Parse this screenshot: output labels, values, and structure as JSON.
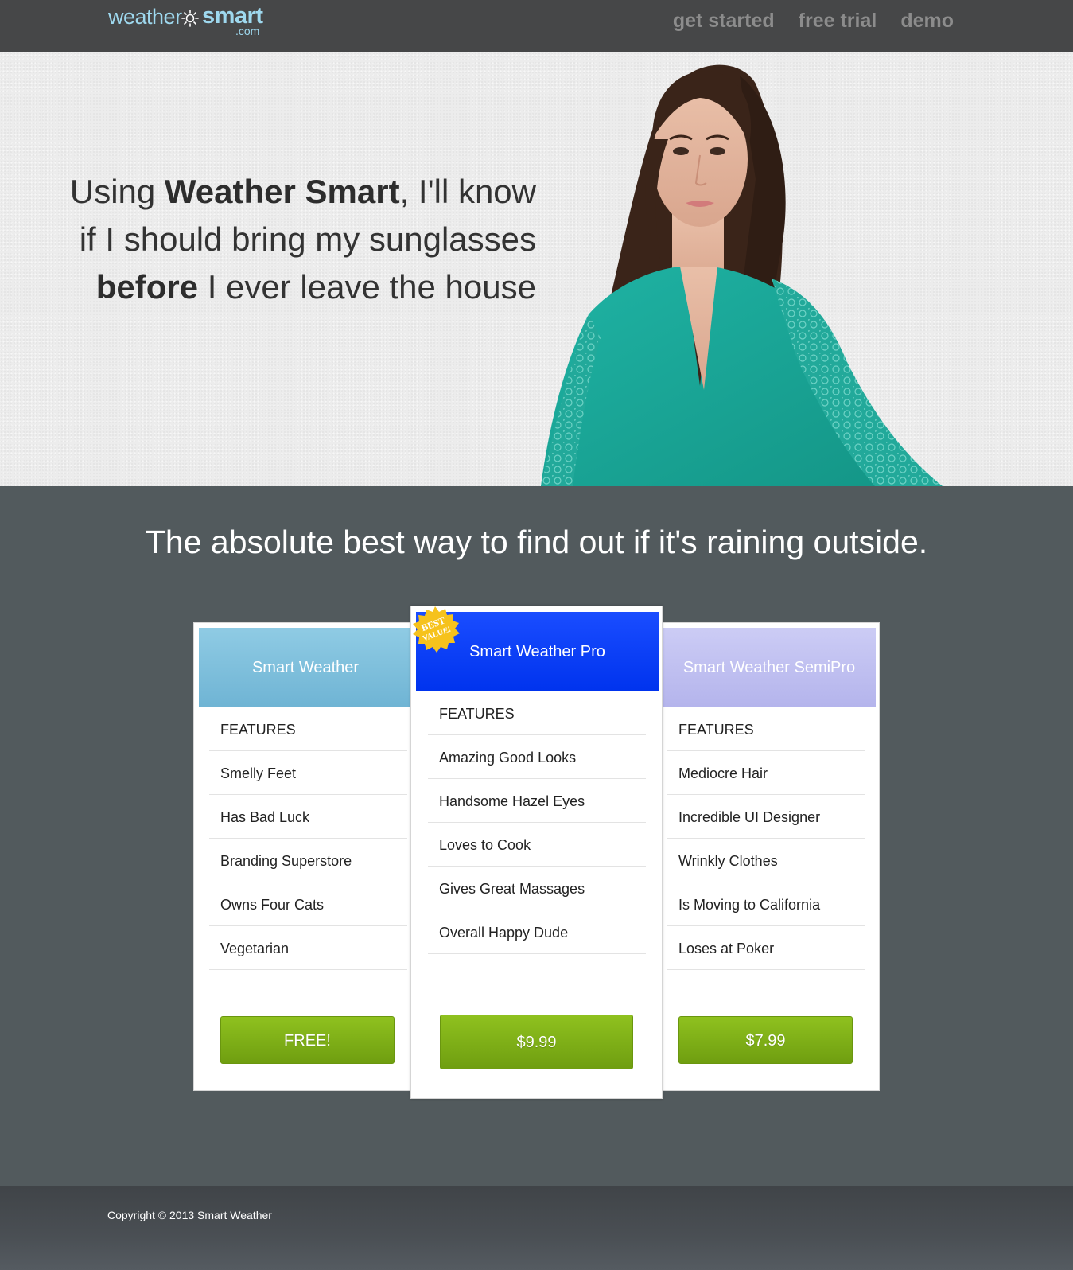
{
  "header": {
    "logo": {
      "word1": "weather",
      "word2": "smart",
      "domain": ".com"
    },
    "nav": [
      "get started",
      "free trial",
      "demo"
    ]
  },
  "hero": {
    "line1_pre": "Using ",
    "line1_bold": "Weather Smart",
    "line1_post": ", I'll know",
    "line2": "if I should bring my sunglasses",
    "line3_bold": "before",
    "line3_post": " I ever leave the house"
  },
  "tagline": "The absolute best way to find out if it's raining outside.",
  "plans": [
    {
      "name": "Smart Weather",
      "features_heading": "FEATURES",
      "features": [
        "Smelly Feet",
        "Has Bad Luck",
        "Branding Superstore",
        "Owns Four Cats",
        "Vegetarian"
      ],
      "price": "FREE!",
      "color": "#7fc0de"
    },
    {
      "name": "Smart Weather Pro",
      "badge": [
        "BEST",
        "VALUE!"
      ],
      "features_heading": "FEATURES",
      "features": [
        "Amazing Good Looks",
        "Handsome Hazel Eyes",
        "Loves to Cook",
        "Gives Great Massages",
        "Overall Happy Dude"
      ],
      "price": "$9.99",
      "color": "#0a3ff5"
    },
    {
      "name": "Smart Weather SemiPro",
      "features_heading": "FEATURES",
      "features": [
        "Mediocre Hair",
        "Incredible UI Designer",
        "Wrinkly Clothes",
        "Is Moving to California",
        "Loses at Poker"
      ],
      "price": "$7.99",
      "color": "#c0c0f2"
    }
  ],
  "footer": {
    "copyright": "Copyright © 2013 Smart Weather"
  },
  "colors": {
    "header_bg": "#464748",
    "body_bg": "#525a5d",
    "button_green": "#7fb018",
    "logo_blue": "#9ed8ee"
  }
}
